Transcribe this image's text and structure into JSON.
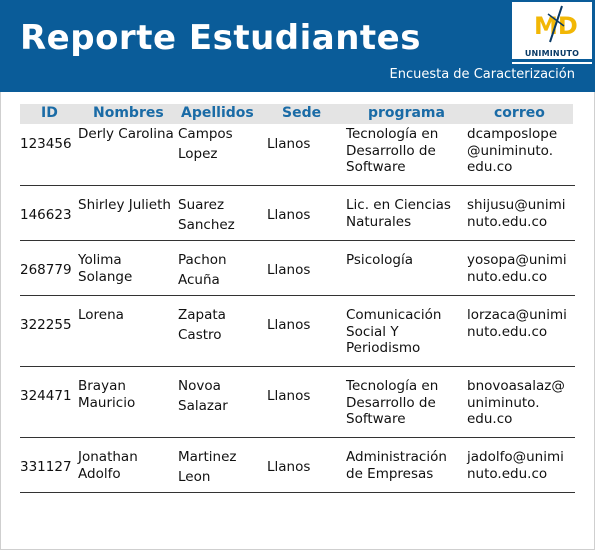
{
  "header": {
    "title": "Reporte Estudiantes",
    "subtitle": "Encuesta de Caracterización",
    "logo_text": "UNIMINUTO",
    "logo_letters": "MD",
    "brand_color": "#0a5c99",
    "logo_accent": "#f2b705"
  },
  "columns": [
    "ID",
    "Nombres",
    "Apellidos",
    "Sede",
    "programa",
    "correo"
  ],
  "rows": [
    {
      "id": "123456",
      "nombres": "Derly Carolina",
      "apellidos": "Campos\nLopez",
      "sede": "Llanos",
      "programa": "Tecnología en\nDesarrollo de\nSoftware",
      "correo": "dcamposlope\n@uniminuto.\nedu.co"
    },
    {
      "id": "146623",
      "nombres": "Shirley Julieth",
      "apellidos": "Suarez\nSanchez",
      "sede": "Llanos",
      "programa": "Lic. en Ciencias\nNaturales",
      "correo": "shijusu@unimi\nnuto.edu.co"
    },
    {
      "id": "268779",
      "nombres": "Yolima\nSolange",
      "apellidos": "Pachon\nAcuña",
      "sede": "Llanos",
      "programa": "Psicología",
      "correo": "yosopa@unimi\nnuto.edu.co"
    },
    {
      "id": "322255",
      "nombres": "Lorena",
      "apellidos": "Zapata\nCastro",
      "sede": "Llanos",
      "programa": "Comunicación\nSocial Y\nPeriodismo",
      "correo": "lorzaca@unimi\nnuto.edu.co"
    },
    {
      "id": "324471",
      "nombres": "Brayan\nMauricio",
      "apellidos": "Novoa\nSalazar",
      "sede": "Llanos",
      "programa": "Tecnología en\nDesarrollo de\nSoftware",
      "correo": "bnovoasalaz@\nuniminuto.\nedu.co"
    },
    {
      "id": "331127",
      "nombres": "Jonathan\nAdolfo",
      "apellidos": "Martinez\nLeon",
      "sede": "Llanos",
      "programa": "Administración\nde Empresas",
      "correo": "jadolfo@unimi\nnuto.edu.co"
    }
  ]
}
